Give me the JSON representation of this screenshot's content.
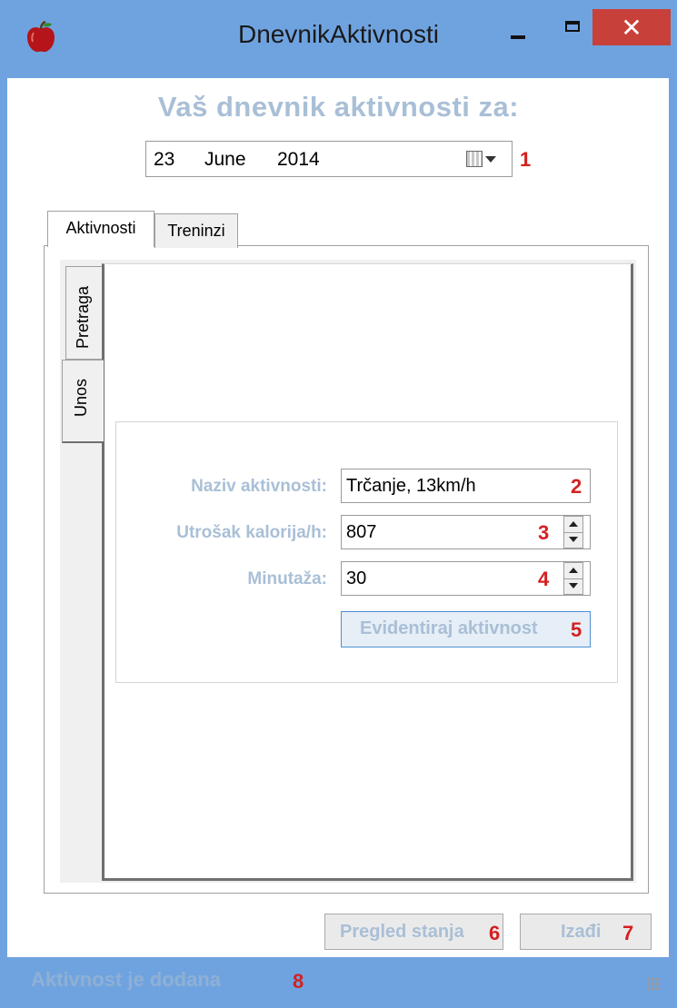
{
  "window": {
    "title": "DnevnikAktivnosti",
    "close_glyph": "✕"
  },
  "header": {
    "heading": "Vaš dnevnik aktivnosti za:"
  },
  "date": {
    "day": "23",
    "month": "June",
    "year": "2014"
  },
  "tabs": [
    {
      "label": "Aktivnosti",
      "active": true
    },
    {
      "label": "Treninzi",
      "active": false
    }
  ],
  "side_tabs": [
    {
      "label": "Pretraga",
      "active": false
    },
    {
      "label": "Unos",
      "active": true
    }
  ],
  "form": {
    "activity_label": "Naziv aktivnosti:",
    "activity_value": "Trčanje, 13km/h",
    "calories_label": "Utrošak kalorija/h:",
    "calories_value": "807",
    "minutes_label": "Minutaža:",
    "minutes_value": "30",
    "submit_label": "Evidentiraj aktivnost"
  },
  "footer": {
    "overview_label": "Pregled stanja",
    "exit_label": "Izađi"
  },
  "status": {
    "text": "Aktivnost je dodana"
  },
  "markers": [
    "1",
    "2",
    "3",
    "4",
    "5",
    "6",
    "7",
    "8"
  ],
  "colors": {
    "titlebar": "#6fa3e0",
    "close": "#c7413a",
    "muted_label": "#a9bfd6",
    "marker": "#d42020"
  }
}
